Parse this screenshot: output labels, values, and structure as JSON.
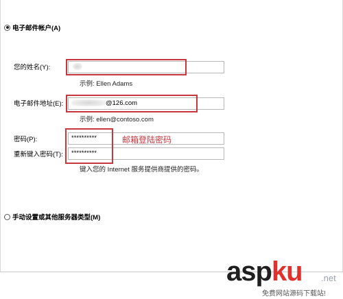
{
  "account": {
    "email_option_label": "电子邮件帐户(A)",
    "manual_option_label": "手动设置或其他服务器类型(M)"
  },
  "form": {
    "name_label": "您的姓名(Y):",
    "name_example": "示例: Ellen Adams",
    "email_label": "电子邮件地址(E):",
    "email_value": "@126.com",
    "email_example": "示例: ellen@contoso.com",
    "password_label": "密码(P):",
    "password_value": "**********",
    "retype_label": "重新键入密码(T):",
    "retype_value": "**********",
    "password_note": "键入您的 Internet 服务提供商提供的密码。"
  },
  "annotation": {
    "text": "邮箱登陆密码",
    "color": "#c9353b"
  },
  "watermark": {
    "brand_main": "asp",
    "brand_accent": "ku",
    "brand_suffix": ".net",
    "subtitle": "免费网站源码下载站!"
  }
}
